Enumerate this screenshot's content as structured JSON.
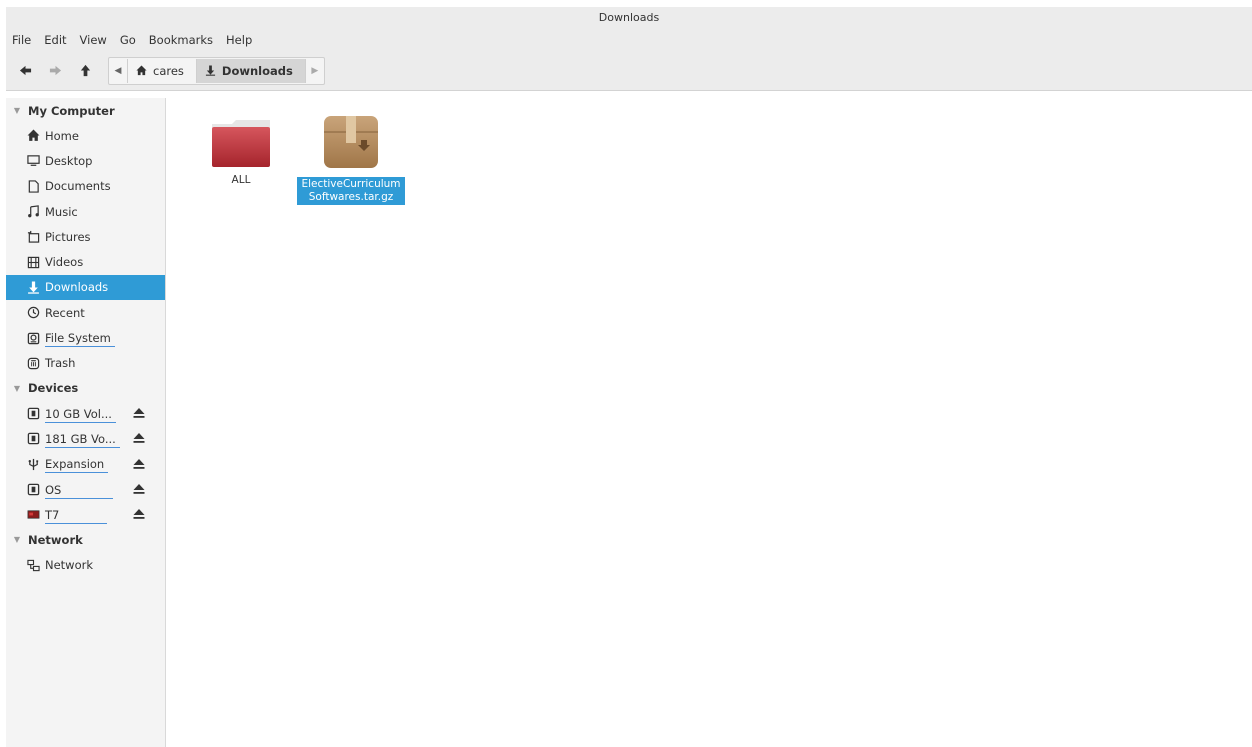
{
  "window": {
    "title": "Downloads"
  },
  "menu": [
    "File",
    "Edit",
    "View",
    "Go",
    "Bookmarks",
    "Help"
  ],
  "toolbar": {
    "back_icon": "back-arrow-icon",
    "forward_icon": "forward-arrow-icon",
    "up_icon": "up-arrow-icon",
    "path": [
      {
        "label": "cares",
        "icon": "home-icon"
      },
      {
        "label": "Downloads",
        "icon": "download-icon",
        "active": true
      }
    ]
  },
  "sidebar": {
    "my_computer": {
      "title": "My Computer",
      "items": [
        {
          "label": "Home",
          "icon": "home-icon"
        },
        {
          "label": "Desktop",
          "icon": "desktop-icon"
        },
        {
          "label": "Documents",
          "icon": "documents-icon"
        },
        {
          "label": "Music",
          "icon": "music-icon"
        },
        {
          "label": "Pictures",
          "icon": "pictures-icon"
        },
        {
          "label": "Videos",
          "icon": "videos-icon"
        },
        {
          "label": "Downloads",
          "icon": "download-icon",
          "selected": true
        },
        {
          "label": "Recent",
          "icon": "recent-icon"
        },
        {
          "label": "File System",
          "icon": "filesystem-icon"
        },
        {
          "label": "Trash",
          "icon": "trash-icon"
        }
      ]
    },
    "devices": {
      "title": "Devices",
      "items": [
        {
          "label": "10 GB Vol...",
          "icon": "drive-icon"
        },
        {
          "label": "181 GB Vo...",
          "icon": "drive-icon"
        },
        {
          "label": "Expansion",
          "icon": "usb-icon"
        },
        {
          "label": "OS",
          "icon": "drive-icon"
        },
        {
          "label": "T7",
          "icon": "external-drive-icon"
        }
      ]
    },
    "network": {
      "title": "Network",
      "items": [
        {
          "label": "Network",
          "icon": "network-icon"
        }
      ]
    }
  },
  "files": [
    {
      "name": "ALL",
      "icon": "folder-icon",
      "color": "#c0343c"
    },
    {
      "name": "ElectiveCurriculumSoftwares.tar.gz",
      "icon": "archive-icon",
      "selected": true,
      "color": "#b0875a"
    }
  ],
  "colors": {
    "accent": "#2f9bd6",
    "chrome": "#ececec",
    "sidebar": "#f4f4f4"
  }
}
